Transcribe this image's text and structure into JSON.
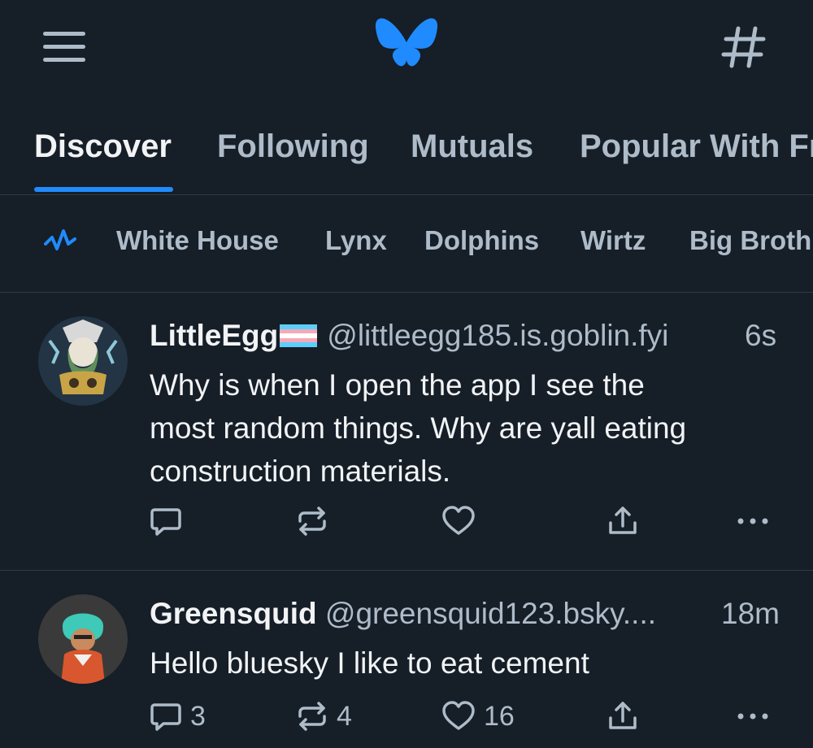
{
  "header": {
    "menu_icon": "hamburger-menu-icon",
    "logo": "bluesky-butterfly-logo",
    "feeds_icon": "hashtag-icon",
    "accent_color": "#208bfe"
  },
  "tabs": [
    {
      "label": "Discover",
      "active": true
    },
    {
      "label": "Following",
      "active": false
    },
    {
      "label": "Mutuals",
      "active": false
    },
    {
      "label": "Popular With Fr",
      "active": false
    }
  ],
  "trending": {
    "icon": "trending-icon",
    "topics": [
      "White House",
      "Lynx",
      "Dolphins",
      "Wirtz",
      "Big Broth"
    ]
  },
  "posts": [
    {
      "display_name": "LittleEgg",
      "name_badge": "transgender-flag-emoji",
      "handle": "@littleegg185.is.goblin.fyi",
      "time": "6s",
      "text_lines": [
        "Why is when I open the app I see the",
        "most random things. Why are yall eating",
        "construction materials."
      ],
      "reply_count": "",
      "repost_count": "",
      "like_count": ""
    },
    {
      "display_name": "Greensquid",
      "handle": "@greensquid123.bsky....",
      "time": "18m",
      "text_lines": [
        "Hello bluesky I like to eat cement"
      ],
      "reply_count": "3",
      "repost_count": "4",
      "like_count": "16"
    }
  ]
}
